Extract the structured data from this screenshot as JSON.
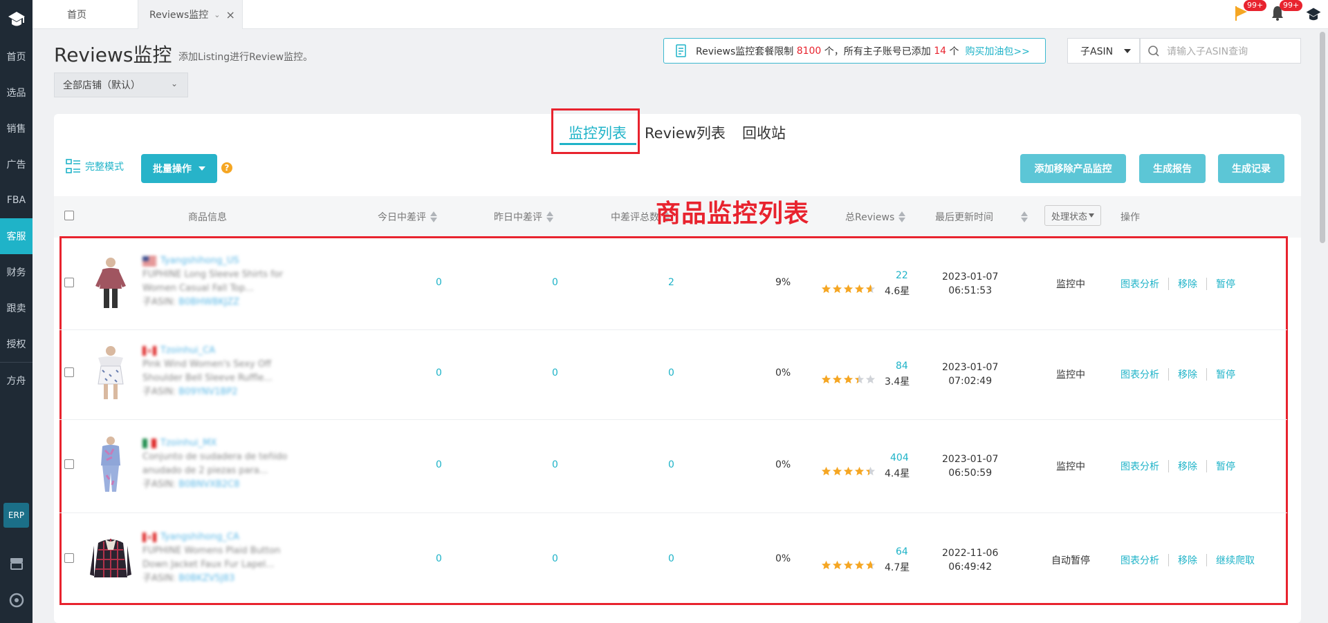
{
  "sidebar": {
    "items": [
      {
        "label": "首页"
      },
      {
        "label": "选品"
      },
      {
        "label": "销售"
      },
      {
        "label": "广告"
      },
      {
        "label": "FBA"
      },
      {
        "label": "客服",
        "active": true
      },
      {
        "label": "财务"
      },
      {
        "label": "跟卖"
      },
      {
        "label": "授权"
      },
      {
        "label": "方舟"
      }
    ],
    "erp_label": "ERP"
  },
  "topbar": {
    "tabs": [
      {
        "label": "首页"
      },
      {
        "label": "Reviews监控"
      }
    ],
    "flag_badge": "99+",
    "bell_badge": "99+"
  },
  "header": {
    "title": "Reviews监控",
    "subtitle": "添加Listing进行Review监控。",
    "store_select": "全部店铺（默认）",
    "notice": {
      "prefix": "Reviews监控套餐限制",
      "limit": "8100",
      "middle": "个，所有主子账号已添加",
      "added": "14",
      "suffix": "个",
      "link": "购买加油包>>"
    },
    "asin_type": "子ASIN",
    "search_placeholder": "请输入子ASIN查询"
  },
  "content_tabs": [
    {
      "label": "监控列表",
      "active": true
    },
    {
      "label": "Review列表"
    },
    {
      "label": "回收站"
    }
  ],
  "toolbar": {
    "mode_label": "完整模式",
    "bulk_label": "批量操作",
    "help": "?",
    "add_remove_label": "添加移除产品监控",
    "report_label": "生成报告",
    "records_label": "生成记录"
  },
  "annotation": "商品监控列表",
  "table": {
    "headers": {
      "product": "商品信息",
      "today_bad": "今日中差评",
      "yesterday_bad": "昨日中差评",
      "bad_total": "中差评总数",
      "total_reviews": "总Reviews",
      "last_update": "最后更新时间",
      "status": "处理状态",
      "ops": "操作"
    },
    "rows": [
      {
        "store": "Tyangshihong_US",
        "title1": "FUPHINE Long Sleeve Shirts for",
        "title2": "Women Casual Fall Top...",
        "asin_label": "子ASIN:",
        "asin": "B0BHWBKJZZ",
        "today": "0",
        "yesterday": "0",
        "bad_total": "2",
        "ratio": "9%",
        "reviews": "22",
        "rating": 4.6,
        "rating_text": "4.6星",
        "date": "2023-01-07",
        "time": "06:51:53",
        "status": "监控中",
        "op1": "图表分析",
        "op2": "移除",
        "op3": "暂停",
        "flag": "US"
      },
      {
        "store": "Tzoinhui_CA",
        "title1": "Pink Wind Women's Sexy Off",
        "title2": "Shoulder Bell Sleeve Ruffle...",
        "asin_label": "子ASIN:",
        "asin": "B09YNV1BP2",
        "today": "0",
        "yesterday": "0",
        "bad_total": "0",
        "ratio": "0%",
        "reviews": "84",
        "rating": 3.4,
        "rating_text": "3.4星",
        "date": "2023-01-07",
        "time": "07:02:49",
        "status": "监控中",
        "op1": "图表分析",
        "op2": "移除",
        "op3": "暂停",
        "flag": "CA"
      },
      {
        "store": "Tzoinhui_MX",
        "title1": "Conjunto de sudadera de teñido",
        "title2": "anudado de 2 piezas para...",
        "asin_label": "子ASIN:",
        "asin": "B0BNVXB2C8",
        "today": "0",
        "yesterday": "0",
        "bad_total": "0",
        "ratio": "0%",
        "reviews": "404",
        "rating": 4.4,
        "rating_text": "4.4星",
        "date": "2023-01-07",
        "time": "06:50:59",
        "status": "监控中",
        "op1": "图表分析",
        "op2": "移除",
        "op3": "暂停",
        "flag": "MX"
      },
      {
        "store": "Tyangshihong_CA",
        "title1": "FUPHINE Womens Plaid Button",
        "title2": "Down Jacket Faux Fur Lapel...",
        "asin_label": "子ASIN:",
        "asin": "B0BKZV5J83",
        "today": "0",
        "yesterday": "0",
        "bad_total": "0",
        "ratio": "0%",
        "reviews": "64",
        "rating": 4.7,
        "rating_text": "4.7星",
        "date": "2022-11-06",
        "time": "06:49:42",
        "status": "自动暂停",
        "op1": "图表分析",
        "op2": "移除",
        "op3": "继续爬取",
        "flag": "CA"
      }
    ]
  },
  "colors": {
    "accent": "#1fb3c8",
    "annotation": "#e8232e",
    "sidebar": "#1f2a35",
    "star": "#f5a623"
  }
}
